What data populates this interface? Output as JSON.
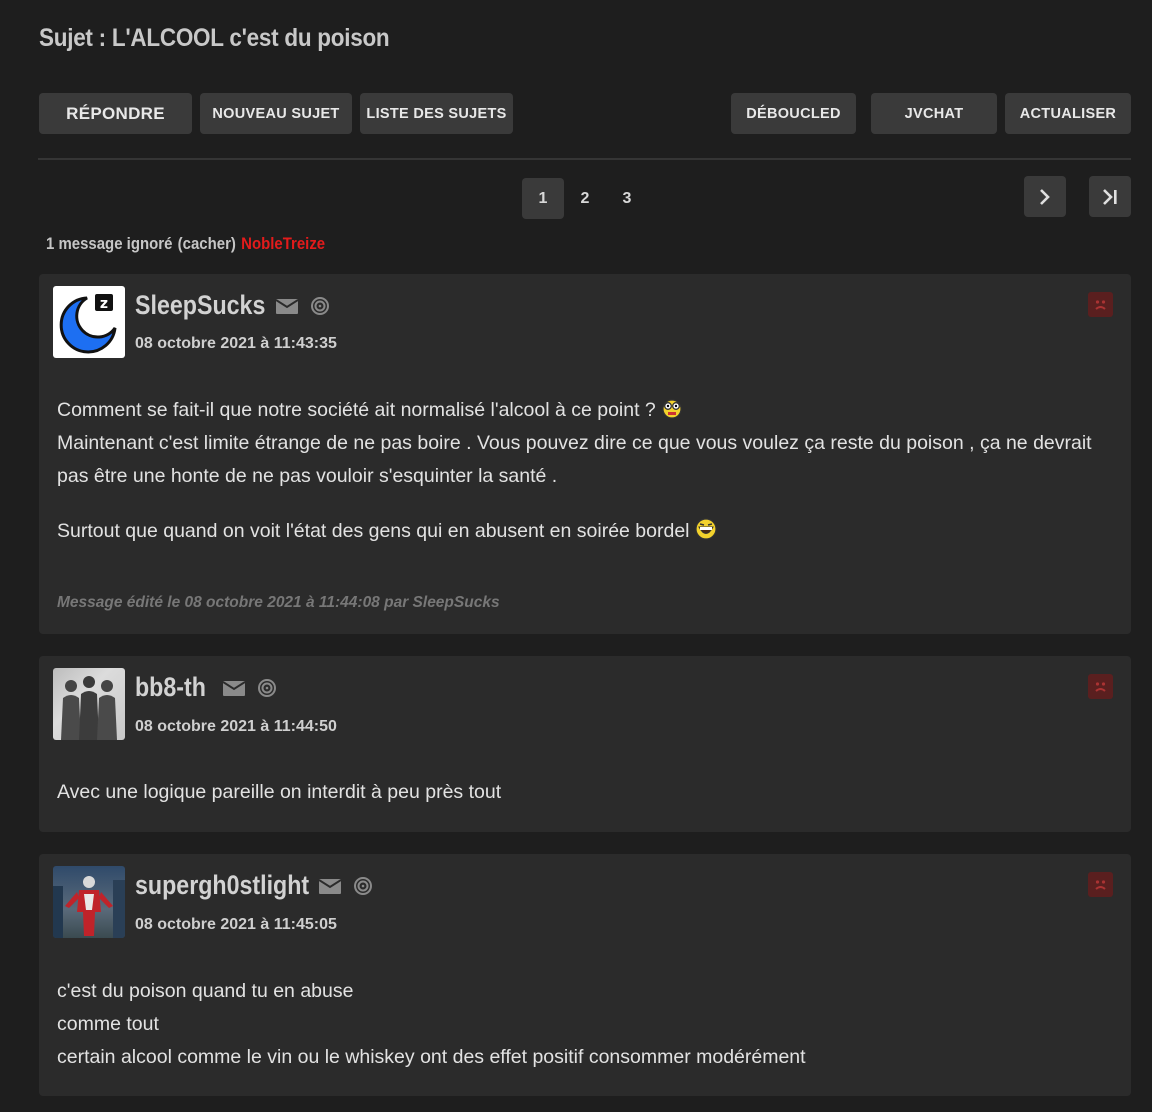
{
  "topic": {
    "title": "Sujet : L'ALCOOL c'est du poison"
  },
  "toolbar": {
    "reply": "RÉPONDRE",
    "new_topic": "NOUVEAU SUJET",
    "topic_list": "LISTE DES SUJETS",
    "deboucled": "DÉBOUCLED",
    "jvchat": "JVCHAT",
    "refresh": "ACTUALISER"
  },
  "pagination": {
    "pages": [
      "1",
      "2",
      "3"
    ],
    "current": "1"
  },
  "ignored": {
    "text": "1 message ignoré",
    "cacher": "(cacher)",
    "user": "NobleTreize"
  },
  "posts": [
    {
      "pseudo": "SleepSucks",
      "date": "08 octobre 2021 à 11:43:35",
      "lines": [
        "Comment se fait-il que notre société ait normalisé l'alcool à ce point ?",
        "Maintenant c'est limite étrange de ne pas boire . Vous pouvez dire ce que vous voulez ça reste du poison , ça ne devrait pas être une honte de ne pas vouloir s'esquinter la santé .",
        "Surtout que quand on voit l'état des gens qui en abusent en soirée bordel"
      ],
      "edited_prefix": "Message édité le 08 octobre 2021 à 11:44:08 par",
      "edited_by": "SleepSucks"
    },
    {
      "pseudo": "bb8-th",
      "date": "08 octobre 2021 à 11:44:50",
      "lines": [
        "Avec une logique pareille on interdit à peu près tout"
      ]
    },
    {
      "pseudo": "supergh0stlight",
      "date": "08 octobre 2021 à 11:45:05",
      "lines": [
        "c'est du poison quand tu en abuse",
        "comme tout",
        "certain alcool comme le vin ou le whiskey ont des effet positif consommer modérément"
      ]
    }
  ],
  "colors": {
    "background": "#1e1e1e",
    "post_bg": "#2b2b2b",
    "button_bg": "#3a3a3a",
    "ignored_user": "#e31b1b",
    "alert": "#5a1f1f"
  }
}
